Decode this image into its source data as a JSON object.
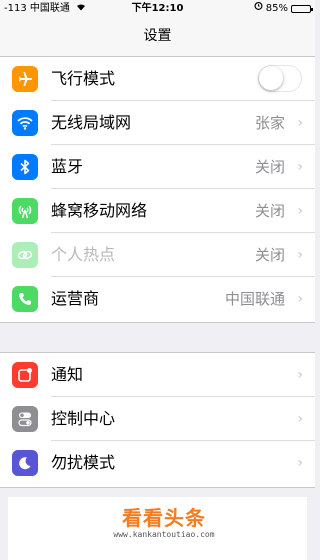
{
  "status_bar": {
    "signal": "-113",
    "carrier": "中国联通",
    "wifi_icon": "wifi-icon",
    "time": "下午12:10",
    "alarm_icon": "alarm-icon",
    "battery_text": "85%",
    "battery_level": 0.85
  },
  "nav": {
    "title": "设置"
  },
  "group1": [
    {
      "key": "airplane",
      "label": "飞行模式",
      "icon": "airplane-icon",
      "icon_color": "#ff9500",
      "toggle": false
    },
    {
      "key": "wifi",
      "label": "无线局域网",
      "icon": "wifi-icon",
      "icon_color": "#007aff",
      "value": "张家"
    },
    {
      "key": "bluetooth",
      "label": "蓝牙",
      "icon": "bluetooth-icon",
      "icon_color": "#007aff",
      "value": "关闭"
    },
    {
      "key": "cellular",
      "label": "蜂窝移动网络",
      "icon": "antenna-icon",
      "icon_color": "#4cd964",
      "value": "关闭"
    },
    {
      "key": "hotspot",
      "label": "个人热点",
      "icon": "hotspot-link-icon",
      "icon_color": "#4cd964",
      "value": "关闭",
      "disabled": true
    },
    {
      "key": "carrier",
      "label": "运营商",
      "icon": "phone-icon",
      "icon_color": "#4cd964",
      "value": "中国联通"
    }
  ],
  "group2": [
    {
      "key": "notifications",
      "label": "通知",
      "icon": "notifications-icon",
      "icon_color": "#ff3b30"
    },
    {
      "key": "control_center",
      "label": "控制中心",
      "icon": "control-center-icon",
      "icon_color": "#8e8e93"
    },
    {
      "key": "dnd",
      "label": "勿扰模式",
      "icon": "moon-icon",
      "icon_color": "#5856d6"
    }
  ],
  "chevron": "›",
  "watermark": {
    "title": "看看头条",
    "url": "www.kankantoutiao.com"
  }
}
